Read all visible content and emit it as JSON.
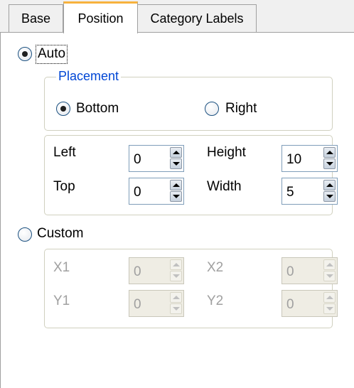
{
  "tabs": [
    {
      "label": "Base"
    },
    {
      "label": "Position"
    },
    {
      "label": "Category Labels"
    }
  ],
  "active_tab": "Position",
  "auto": {
    "label": "Auto",
    "selected": true
  },
  "placement": {
    "legend": "Placement",
    "bottom": {
      "label": "Bottom",
      "selected": true
    },
    "right": {
      "label": "Right",
      "selected": false
    }
  },
  "auto_fields": {
    "left": {
      "label": "Left",
      "value": "0"
    },
    "top": {
      "label": "Top",
      "value": "0"
    },
    "height": {
      "label": "Height",
      "value": "10"
    },
    "width": {
      "label": "Width",
      "value": "5"
    }
  },
  "custom": {
    "label": "Custom",
    "selected": false
  },
  "custom_fields": {
    "x1": {
      "label": "X1",
      "value": "0"
    },
    "y1": {
      "label": "Y1",
      "value": "0"
    },
    "x2": {
      "label": "X2",
      "value": "0"
    },
    "y2": {
      "label": "Y2",
      "value": "0"
    }
  },
  "colors": {
    "active_tab_accent": "#f7b23d",
    "group_legend": "#0046d5",
    "disabled_text": "#a0a0a0"
  }
}
